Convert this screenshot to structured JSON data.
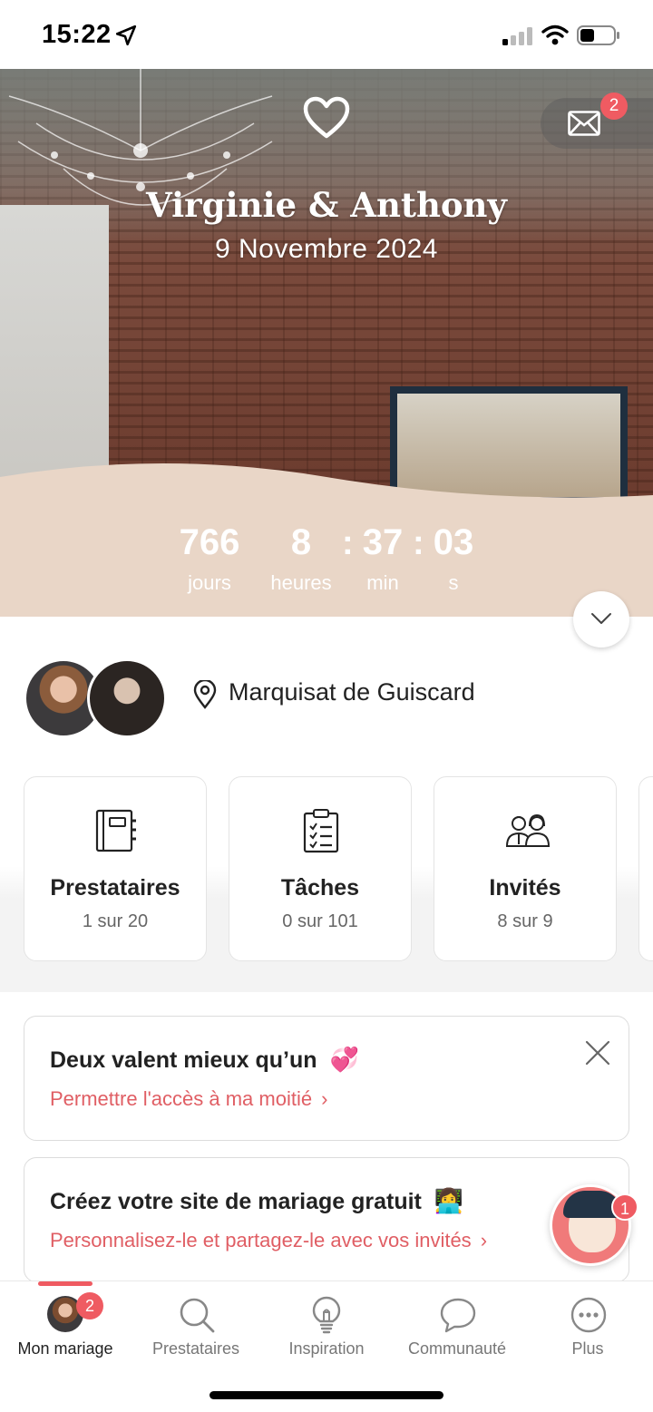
{
  "status_bar": {
    "time": "15:22"
  },
  "hero": {
    "couple_names": "Virginie & Anthony",
    "wedding_date": "9 Novembre 2024",
    "messages_badge": "2",
    "countdown": {
      "days": "766",
      "days_label": "jours",
      "hours": "8",
      "hours_label": "heures",
      "minutes": "37",
      "minutes_label": "min",
      "seconds": "03",
      "seconds_label": "s",
      "separator": ":"
    }
  },
  "venue": {
    "name": "Marquisat de Guiscard"
  },
  "stats": [
    {
      "title": "Prestataires",
      "subtitle": "1 sur 20"
    },
    {
      "title": "Tâches",
      "subtitle": "0 sur 101"
    },
    {
      "title": "Invités",
      "subtitle": "8 sur 9"
    }
  ],
  "promos": [
    {
      "title": "Deux valent mieux qu’un",
      "emoji": "💞",
      "link": "Permettre l'accès à ma moitié",
      "chevron": "›"
    },
    {
      "title": "Créez votre site de mariage gratuit",
      "emoji": "👩‍💻",
      "link": "Personnalisez-le et partagez-le avec vos invités",
      "chevron": "›"
    }
  ],
  "assistant": {
    "badge": "1"
  },
  "tab_bar": {
    "tabs": [
      {
        "label": "Mon mariage",
        "badge": "2"
      },
      {
        "label": "Prestataires"
      },
      {
        "label": "Inspiration"
      },
      {
        "label": "Communauté"
      },
      {
        "label": "Plus"
      }
    ]
  },
  "colors": {
    "accent": "#ef5b62",
    "link": "#e05e64",
    "hero_band": "#e9d6c7"
  }
}
